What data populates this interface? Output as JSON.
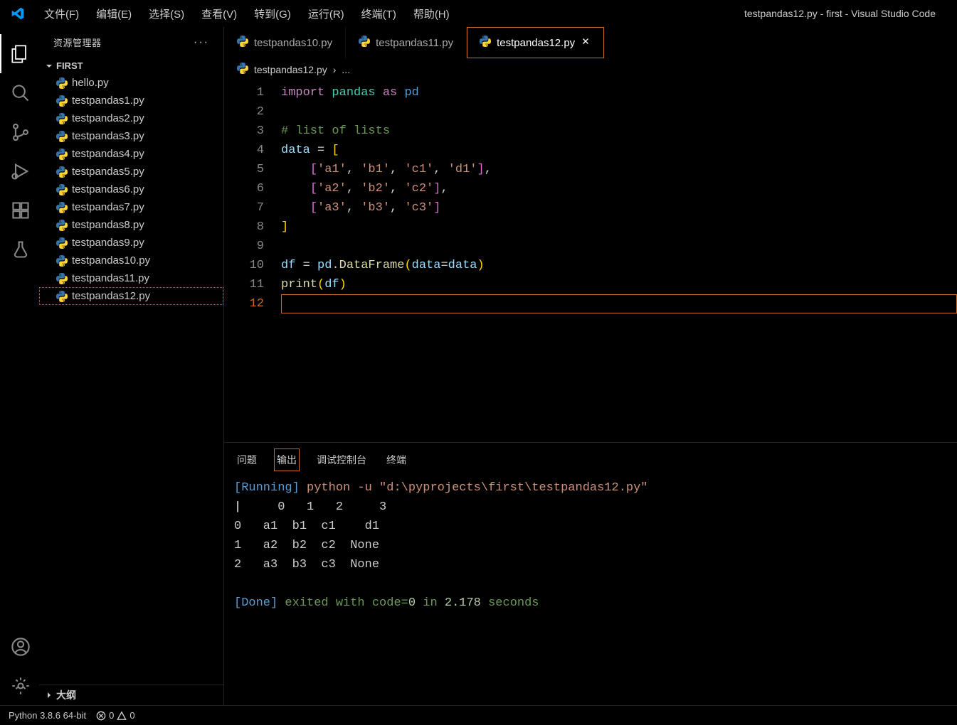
{
  "window_title": "testpandas12.py - first - Visual Studio Code",
  "menu": [
    "文件(F)",
    "编辑(E)",
    "选择(S)",
    "查看(V)",
    "转到(G)",
    "运行(R)",
    "终端(T)",
    "帮助(H)"
  ],
  "sidebar": {
    "title": "资源管理器",
    "folder": "FIRST",
    "files": [
      "hello.py",
      "testpandas1.py",
      "testpandas2.py",
      "testpandas3.py",
      "testpandas4.py",
      "testpandas5.py",
      "testpandas6.py",
      "testpandas7.py",
      "testpandas8.py",
      "testpandas9.py",
      "testpandas10.py",
      "testpandas11.py",
      "testpandas12.py"
    ],
    "selected": "testpandas12.py",
    "outline": "大纲"
  },
  "tabs": [
    {
      "label": "testpandas10.py",
      "active": false
    },
    {
      "label": "testpandas11.py",
      "active": false
    },
    {
      "label": "testpandas12.py",
      "active": true
    }
  ],
  "breadcrumb": {
    "file": "testpandas12.py",
    "sep": "›",
    "more": "..."
  },
  "code": {
    "lines": [
      {
        "n": "1",
        "seg": [
          [
            "kw",
            "import "
          ],
          [
            "mod",
            "pandas "
          ],
          [
            "kw",
            "as "
          ],
          [
            "op",
            "pd"
          ]
        ]
      },
      {
        "n": "2",
        "seg": []
      },
      {
        "n": "3",
        "seg": [
          [
            "cm",
            "# list of lists"
          ]
        ]
      },
      {
        "n": "4",
        "seg": [
          [
            "id",
            "data"
          ],
          [
            "pl",
            " = "
          ],
          [
            "br",
            "["
          ]
        ]
      },
      {
        "n": "5",
        "seg": [
          [
            "pl",
            "    "
          ],
          [
            "br2",
            "["
          ],
          [
            "str",
            "'a1'"
          ],
          [
            "pl",
            ", "
          ],
          [
            "str",
            "'b1'"
          ],
          [
            "pl",
            ", "
          ],
          [
            "str",
            "'c1'"
          ],
          [
            "pl",
            ", "
          ],
          [
            "str",
            "'d1'"
          ],
          [
            "br2",
            "]"
          ],
          [
            "pl",
            ","
          ]
        ]
      },
      {
        "n": "6",
        "seg": [
          [
            "pl",
            "    "
          ],
          [
            "br2",
            "["
          ],
          [
            "str",
            "'a2'"
          ],
          [
            "pl",
            ", "
          ],
          [
            "str",
            "'b2'"
          ],
          [
            "pl",
            ", "
          ],
          [
            "str",
            "'c2'"
          ],
          [
            "br2",
            "]"
          ],
          [
            "pl",
            ","
          ]
        ]
      },
      {
        "n": "7",
        "seg": [
          [
            "pl",
            "    "
          ],
          [
            "br2",
            "["
          ],
          [
            "str",
            "'a3'"
          ],
          [
            "pl",
            ", "
          ],
          [
            "str",
            "'b3'"
          ],
          [
            "pl",
            ", "
          ],
          [
            "str",
            "'c3'"
          ],
          [
            "br2",
            "]"
          ]
        ]
      },
      {
        "n": "8",
        "seg": [
          [
            "br",
            "]"
          ]
        ]
      },
      {
        "n": "9",
        "seg": []
      },
      {
        "n": "10",
        "seg": [
          [
            "id",
            "df"
          ],
          [
            "pl",
            " = "
          ],
          [
            "id",
            "pd"
          ],
          [
            "pl",
            "."
          ],
          [
            "fn",
            "DataFrame"
          ],
          [
            "br",
            "("
          ],
          [
            "id",
            "data"
          ],
          [
            "pl",
            "="
          ],
          [
            "id",
            "data"
          ],
          [
            "br",
            ")"
          ]
        ]
      },
      {
        "n": "11",
        "seg": [
          [
            "fn",
            "print"
          ],
          [
            "br",
            "("
          ],
          [
            "id",
            "df"
          ],
          [
            "br",
            ")"
          ]
        ]
      },
      {
        "n": "12",
        "seg": [],
        "current": true
      }
    ]
  },
  "panel": {
    "tabs": [
      "问题",
      "输出",
      "调试控制台",
      "终端"
    ],
    "active_tab": "输出",
    "output": {
      "running": "[Running]",
      "cmd": " python -u ",
      "path": "\"d:\\pyprojects\\first\\testpandas12.py\"",
      "body": "     0   1   2     3\n0   a1  b1  c1    d1\n1   a2  b2  c2  None\n2   a3  b3  c3  None\n",
      "done_label": "[Done]",
      "done_text": " exited with code=",
      "done_code": "0",
      "done_text2": " in ",
      "done_time": "2.178",
      "done_text3": " seconds"
    }
  },
  "statusbar": {
    "python": "Python 3.8.6 64-bit",
    "errors": "0",
    "warnings": "0"
  }
}
